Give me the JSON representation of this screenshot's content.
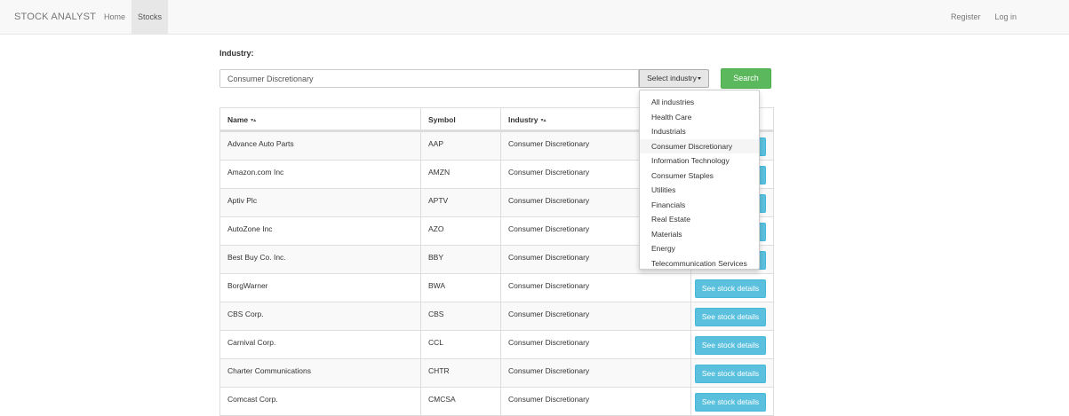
{
  "navbar": {
    "brand": "STOCK ANALYST",
    "links": [
      {
        "label": "Home",
        "active": false
      },
      {
        "label": "Stocks",
        "active": true
      }
    ],
    "right_links": [
      {
        "label": "Register"
      },
      {
        "label": "Log in"
      }
    ]
  },
  "filter": {
    "label": "Industry:",
    "value": "Consumer Discretionary",
    "select_label": "Select industry",
    "search_label": "Search"
  },
  "dropdown": {
    "items": [
      "All industries",
      "Health Care",
      "Industrials",
      "Consumer Discretionary",
      "Information Technology",
      "Consumer Staples",
      "Utilities",
      "Financials",
      "Real Estate",
      "Materials",
      "Energy",
      "Telecommunication Services"
    ],
    "highlighted": "Consumer Discretionary"
  },
  "table": {
    "headers": {
      "name": "Name",
      "symbol": "Symbol",
      "industry": "Industry",
      "sort_arrows": "▾▴"
    },
    "button_label": "See stock details",
    "rows": [
      {
        "name": "Advance Auto Parts",
        "symbol": "AAP",
        "industry": "Consumer Discretionary"
      },
      {
        "name": "Amazon.com Inc",
        "symbol": "AMZN",
        "industry": "Consumer Discretionary"
      },
      {
        "name": "Aptiv Plc",
        "symbol": "APTV",
        "industry": "Consumer Discretionary"
      },
      {
        "name": "AutoZone Inc",
        "symbol": "AZO",
        "industry": "Consumer Discretionary"
      },
      {
        "name": "Best Buy Co. Inc.",
        "symbol": "BBY",
        "industry": "Consumer Discretionary"
      },
      {
        "name": "BorgWarner",
        "symbol": "BWA",
        "industry": "Consumer Discretionary"
      },
      {
        "name": "CBS Corp.",
        "symbol": "CBS",
        "industry": "Consumer Discretionary"
      },
      {
        "name": "Carnival Corp.",
        "symbol": "CCL",
        "industry": "Consumer Discretionary"
      },
      {
        "name": "Charter Communications",
        "symbol": "CHTR",
        "industry": "Consumer Discretionary"
      },
      {
        "name": "Comcast Corp.",
        "symbol": "CMCSA",
        "industry": "Consumer Discretionary"
      }
    ]
  },
  "colors": {
    "search_button": "#5cb85c",
    "details_button": "#5bc0de",
    "navbar_bg": "#f8f8f8"
  }
}
